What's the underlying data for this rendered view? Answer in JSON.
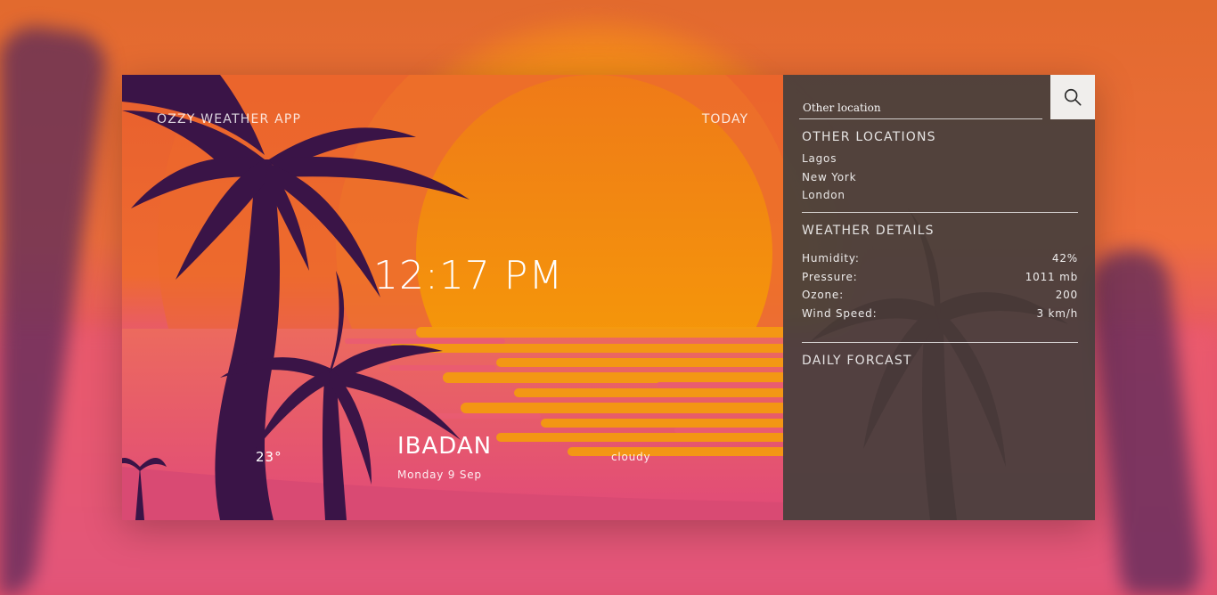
{
  "app": {
    "title": "OZZY WEATHER APP",
    "today_label": "TODAY"
  },
  "current": {
    "time": "12:17 PM",
    "temperature": "23°",
    "city": "IBADAN",
    "date": "Monday 9 Sep",
    "condition": "cloudy"
  },
  "search": {
    "placeholder": "Other location",
    "button_icon": "search-icon"
  },
  "other_locations": {
    "title": "OTHER LOCATIONS",
    "items": [
      "Lagos",
      "New York",
      "London"
    ]
  },
  "weather_details": {
    "title": "WEATHER DETAILS",
    "rows": [
      {
        "label": "Humidity:",
        "value": "42%"
      },
      {
        "label": "Pressure:",
        "value": "1011 mb"
      },
      {
        "label": "Ozone:",
        "value": "200"
      },
      {
        "label": "Wind Speed:",
        "value": "3 km/h"
      }
    ]
  },
  "daily_forecast": {
    "title": "DAILY FORCAST"
  },
  "colors": {
    "palm": "#3a1447",
    "sun": "#f39012",
    "panel": "#463e3c",
    "sky": "#e8602e",
    "sea": "#e2507a"
  }
}
